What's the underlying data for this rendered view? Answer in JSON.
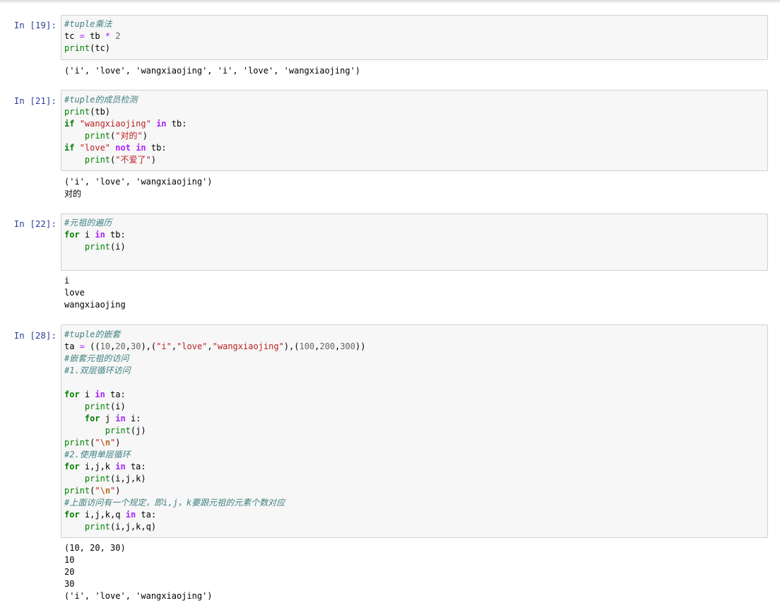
{
  "cells": [
    {
      "prompt": "In  [19]:",
      "code": [
        [
          {
            "t": "#tuple乘法",
            "c": "cm"
          }
        ],
        [
          {
            "t": "tc "
          },
          {
            "t": "=",
            "c": "op"
          },
          {
            "t": " tb "
          },
          {
            "t": "*",
            "c": "op"
          },
          {
            "t": " "
          },
          {
            "t": "2",
            "c": "nu"
          }
        ],
        [
          {
            "t": "print",
            "c": "bi"
          },
          {
            "t": "(tc)"
          }
        ]
      ],
      "output": [
        "('i', 'love', 'wangxiaojing', 'i', 'love', 'wangxiaojing')"
      ]
    },
    {
      "prompt": "In  [21]:",
      "code": [
        [
          {
            "t": "#tuple的成员检测",
            "c": "cm"
          }
        ],
        [
          {
            "t": "print",
            "c": "bi"
          },
          {
            "t": "(tb)"
          }
        ],
        [
          {
            "t": "if",
            "c": "kw"
          },
          {
            "t": " "
          },
          {
            "t": "\"wangxiaojing\"",
            "c": "st"
          },
          {
            "t": " "
          },
          {
            "t": "in",
            "c": "owk"
          },
          {
            "t": " tb:"
          }
        ],
        [
          {
            "t": "    "
          },
          {
            "t": "print",
            "c": "bi"
          },
          {
            "t": "("
          },
          {
            "t": "\"对的\"",
            "c": "st"
          },
          {
            "t": ")"
          }
        ],
        [
          {
            "t": "if",
            "c": "kw"
          },
          {
            "t": " "
          },
          {
            "t": "\"love\"",
            "c": "st"
          },
          {
            "t": " "
          },
          {
            "t": "not",
            "c": "owk"
          },
          {
            "t": " "
          },
          {
            "t": "in",
            "c": "owk"
          },
          {
            "t": " tb:"
          }
        ],
        [
          {
            "t": "    "
          },
          {
            "t": "print",
            "c": "bi"
          },
          {
            "t": "("
          },
          {
            "t": "\"不爱了\"",
            "c": "st"
          },
          {
            "t": ")"
          }
        ]
      ],
      "output": [
        "('i', 'love', 'wangxiaojing')",
        "对的"
      ]
    },
    {
      "prompt": "In  [22]:",
      "code": [
        [
          {
            "t": "#元祖的遍历",
            "c": "cm"
          }
        ],
        [
          {
            "t": "for",
            "c": "kw"
          },
          {
            "t": " i "
          },
          {
            "t": "in",
            "c": "owk"
          },
          {
            "t": " tb:"
          }
        ],
        [
          {
            "t": "    "
          },
          {
            "t": "print",
            "c": "bi"
          },
          {
            "t": "(i)"
          }
        ],
        [
          {
            "t": ""
          }
        ]
      ],
      "output": [
        "i",
        "love",
        "wangxiaojing"
      ]
    },
    {
      "prompt": "In  [28]:",
      "code": [
        [
          {
            "t": "#tuple的嵌套",
            "c": "cm"
          }
        ],
        [
          {
            "t": "ta "
          },
          {
            "t": "=",
            "c": "op"
          },
          {
            "t": " (("
          },
          {
            "t": "10",
            "c": "nu"
          },
          {
            "t": ","
          },
          {
            "t": "20",
            "c": "nu"
          },
          {
            "t": ","
          },
          {
            "t": "30",
            "c": "nu"
          },
          {
            "t": "),("
          },
          {
            "t": "\"i\"",
            "c": "st"
          },
          {
            "t": ","
          },
          {
            "t": "\"love\"",
            "c": "st"
          },
          {
            "t": ","
          },
          {
            "t": "\"wangxiaojing\"",
            "c": "st"
          },
          {
            "t": "),("
          },
          {
            "t": "100",
            "c": "nu"
          },
          {
            "t": ","
          },
          {
            "t": "200",
            "c": "nu"
          },
          {
            "t": ","
          },
          {
            "t": "300",
            "c": "nu"
          },
          {
            "t": "))"
          }
        ],
        [
          {
            "t": "#嵌套元祖的访问",
            "c": "cm"
          }
        ],
        [
          {
            "t": "#1.双层循环访问",
            "c": "cm"
          }
        ],
        [
          {
            "t": ""
          }
        ],
        [
          {
            "t": "for",
            "c": "kw"
          },
          {
            "t": " i "
          },
          {
            "t": "in",
            "c": "owk"
          },
          {
            "t": " ta:"
          }
        ],
        [
          {
            "t": "    "
          },
          {
            "t": "print",
            "c": "bi"
          },
          {
            "t": "(i)"
          }
        ],
        [
          {
            "t": "    "
          },
          {
            "t": "for",
            "c": "kw"
          },
          {
            "t": " j "
          },
          {
            "t": "in",
            "c": "owk"
          },
          {
            "t": " i:"
          }
        ],
        [
          {
            "t": "        "
          },
          {
            "t": "print",
            "c": "bi"
          },
          {
            "t": "(j)"
          }
        ],
        [
          {
            "t": "print",
            "c": "bi"
          },
          {
            "t": "("
          },
          {
            "t": "\"",
            "c": "st"
          },
          {
            "t": "\\n",
            "c": "esc"
          },
          {
            "t": "\"",
            "c": "st"
          },
          {
            "t": ")"
          }
        ],
        [
          {
            "t": "#2.使用单层循环",
            "c": "cm"
          }
        ],
        [
          {
            "t": "for",
            "c": "kw"
          },
          {
            "t": " i,j,k "
          },
          {
            "t": "in",
            "c": "owk"
          },
          {
            "t": " ta:"
          }
        ],
        [
          {
            "t": "    "
          },
          {
            "t": "print",
            "c": "bi"
          },
          {
            "t": "(i,j,k)"
          }
        ],
        [
          {
            "t": "print",
            "c": "bi"
          },
          {
            "t": "("
          },
          {
            "t": "\"",
            "c": "st"
          },
          {
            "t": "\\n",
            "c": "esc"
          },
          {
            "t": "\"",
            "c": "st"
          },
          {
            "t": ")"
          }
        ],
        [
          {
            "t": "#上面访问有一个规定，即i,j，k要跟元祖的元素个数对应",
            "c": "cm"
          }
        ],
        [
          {
            "t": "for",
            "c": "kw"
          },
          {
            "t": " i,j,k,q "
          },
          {
            "t": "in",
            "c": "owk"
          },
          {
            "t": " ta:"
          }
        ],
        [
          {
            "t": "    "
          },
          {
            "t": "print",
            "c": "bi"
          },
          {
            "t": "(i,j,k,q)"
          }
        ]
      ],
      "output": [
        "(10, 20, 30)",
        "10",
        "20",
        "30",
        "('i', 'love', 'wangxiaojing')"
      ]
    }
  ]
}
